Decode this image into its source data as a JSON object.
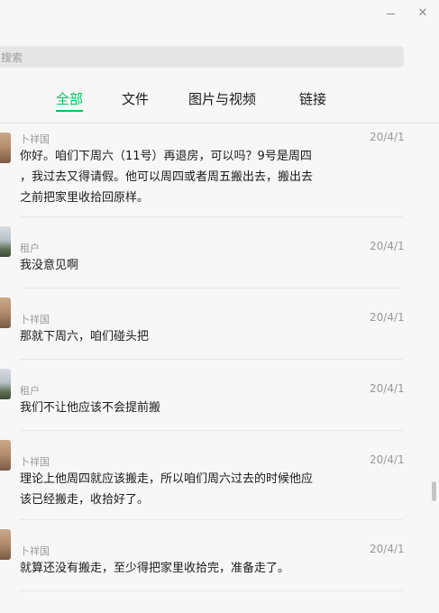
{
  "window": {
    "minimize_icon": "minimize-icon",
    "close_icon": "close-icon",
    "close_glyph": "✕"
  },
  "search": {
    "placeholder": "搜索"
  },
  "tabs": [
    {
      "label": "全部",
      "active": true
    },
    {
      "label": "文件",
      "active": false
    },
    {
      "label": "图片与视频",
      "active": false
    },
    {
      "label": "链接",
      "active": false
    }
  ],
  "accent_color": "#07c160",
  "messages": [
    {
      "sender": "卜祥国",
      "date": "20/4/1",
      "content": "你好。咱们下周六（11号）再退房，可以吗？9号是周四\n，我过去又得请假。他可以周四或者周五搬出去，搬出去\n之前把家里收拾回原样。"
    },
    {
      "sender": "租户",
      "date": "20/4/1",
      "content": "我没意见啊"
    },
    {
      "sender": "卜祥国",
      "date": "20/4/1",
      "content": "那就下周六，咱们碰头把"
    },
    {
      "sender": "租户",
      "date": "20/4/1",
      "content": "我们不让他应该不会提前搬"
    },
    {
      "sender": "卜祥国",
      "date": "20/4/1",
      "content": "理论上他周四就应该搬走，所以咱们周六过去的时候他应\n该已经搬走，收拾好了。"
    },
    {
      "sender": "卜祥国",
      "date": "20/4/1",
      "content": "就算还没有搬走，至少得把家里收拾完，准备走了。"
    }
  ]
}
